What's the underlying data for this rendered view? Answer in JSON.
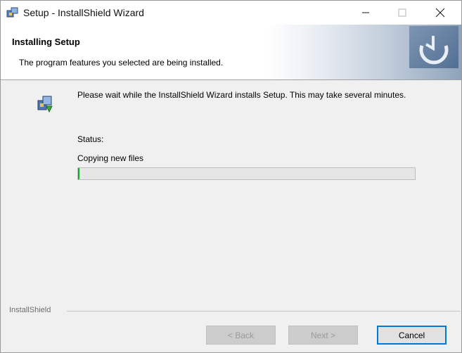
{
  "window": {
    "title": "Setup - InstallShield Wizard",
    "controls": {
      "minimize": "minimize-icon",
      "maximize": "maximize-icon",
      "close": "close-icon"
    }
  },
  "header": {
    "title": "Installing Setup",
    "subtitle": "The program features you selected are being installed."
  },
  "main": {
    "description": "Please wait while the InstallShield Wizard installs Setup. This may take several minutes.",
    "status_label": "Status:",
    "status_text": "Copying new files",
    "progress_fraction": 0.005
  },
  "footer": {
    "brand": "InstallShield",
    "back_label": "< Back",
    "next_label": "Next >",
    "cancel_label": "Cancel"
  },
  "colors": {
    "progress_fill": "#06b025",
    "focus_border": "#0078d7",
    "header_banner": "#526f93"
  }
}
